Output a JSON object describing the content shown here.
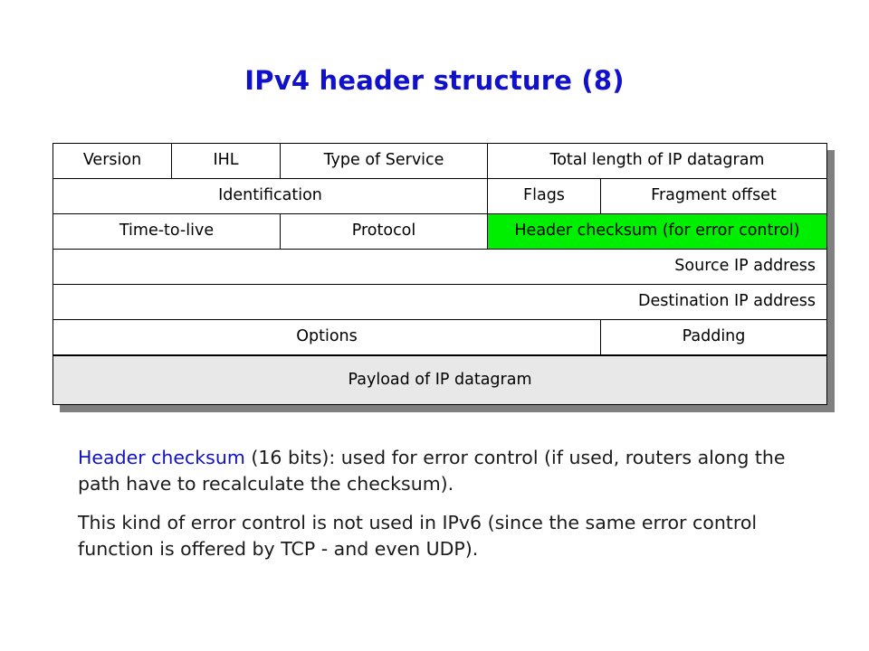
{
  "slide": {
    "title": "IPv4 header structure (8)",
    "title_color": "#1111CC",
    "background": "#FFFFFF"
  },
  "diagram": {
    "name": "IPv4 header structure table",
    "highlight_color": "#00EE00",
    "payload_color": "#E8E8E8",
    "shadow_color": "#808080",
    "rows": [
      {
        "cells": [
          {
            "label": "Version",
            "align": "center"
          },
          {
            "label": "IHL",
            "align": "center"
          },
          {
            "label": "Type of Service",
            "align": "center"
          },
          {
            "label": "Total length of IP datagram",
            "align": "center"
          }
        ]
      },
      {
        "cells": [
          {
            "label": "Identification",
            "align": "center"
          },
          {
            "label": "Flags",
            "align": "center"
          },
          {
            "label": "Fragment offset",
            "align": "center"
          }
        ]
      },
      {
        "cells": [
          {
            "label": "Time-to-live",
            "align": "center"
          },
          {
            "label": "Protocol",
            "align": "center"
          },
          {
            "label": "Header checksum (for error control)",
            "align": "center",
            "highlight": true
          }
        ]
      },
      {
        "cells": [
          {
            "label": "Source IP address",
            "align": "right"
          }
        ]
      },
      {
        "cells": [
          {
            "label": "Destination IP address",
            "align": "right"
          }
        ]
      },
      {
        "cells": [
          {
            "label": "Options",
            "align": "center"
          },
          {
            "label": "Padding",
            "align": "center"
          }
        ]
      },
      {
        "cells": [
          {
            "label": "Payload of IP datagram",
            "align": "center",
            "payload": true
          }
        ]
      }
    ],
    "cell_labels": {
      "version": "Version",
      "ihl": "IHL",
      "tos": "Type of Service",
      "total_length": "Total length of IP datagram",
      "identification": "Identification",
      "flags": "Flags",
      "fragment_offset": "Fragment offset",
      "ttl": "Time-to-live",
      "protocol": "Protocol",
      "header_checksum": "Header checksum (for error control)",
      "source_ip": "Source IP address",
      "destination_ip": "Destination IP address",
      "options": "Options",
      "padding": "Padding",
      "payload": "Payload of IP datagram"
    }
  },
  "body": {
    "paragraph1": {
      "highlight": "Header checksum",
      "rest": " (16 bits): used for error control (if used, routers along the path have to recalculate the checksum)."
    },
    "paragraph2": {
      "text": "This kind of error control is not used in IPv6 (since the same error control function is offered by TCP - and even UDP)."
    }
  }
}
